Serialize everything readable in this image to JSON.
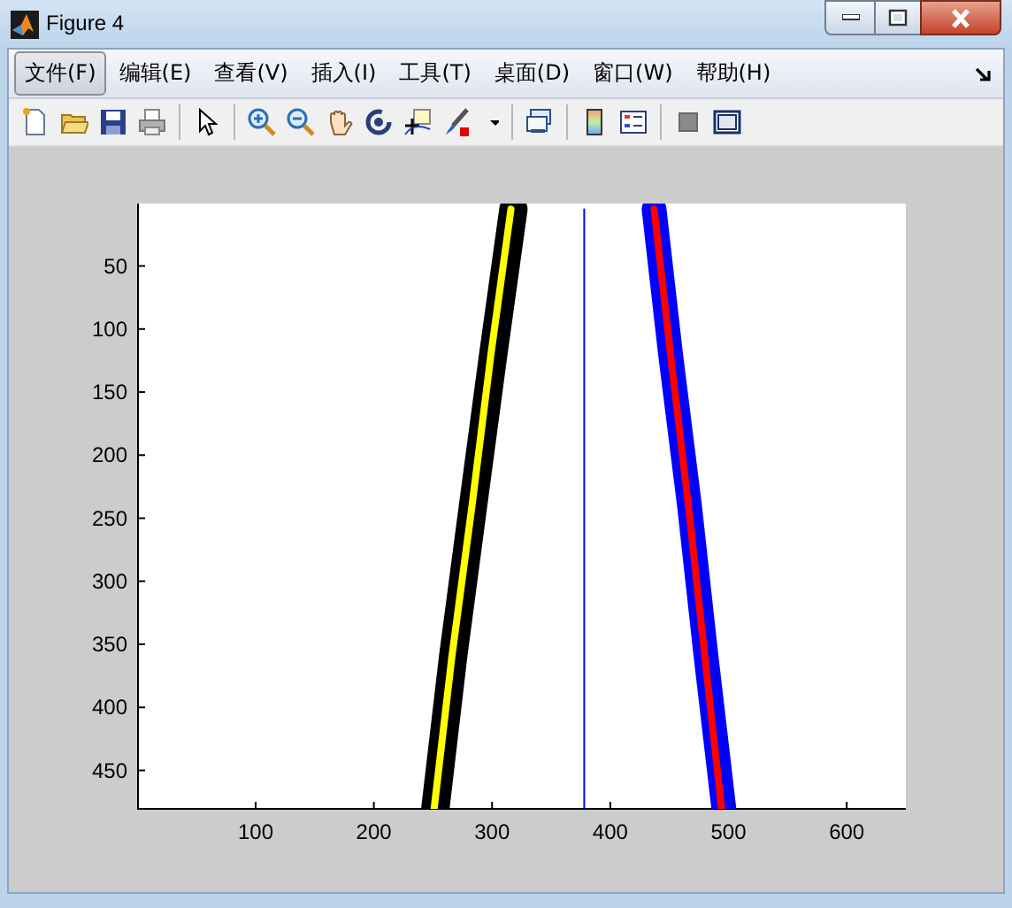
{
  "window": {
    "title": "Figure 4"
  },
  "menu": [
    {
      "label": "文件(F)",
      "selected": true
    },
    {
      "label": "编辑(E)",
      "selected": false
    },
    {
      "label": "查看(V)",
      "selected": false
    },
    {
      "label": "插入(I)",
      "selected": false
    },
    {
      "label": "工具(T)",
      "selected": false
    },
    {
      "label": "桌面(D)",
      "selected": false
    },
    {
      "label": "窗口(W)",
      "selected": false
    },
    {
      "label": "帮助(H)",
      "selected": false
    }
  ],
  "figure": {
    "chart_data": {
      "type": "line",
      "orientation": "horizontal",
      "x": [
        5,
        120,
        240,
        360,
        480
      ],
      "xlim": [
        0.5,
        650
      ],
      "ylim": [
        480.5,
        0.5
      ],
      "xticks": [
        100,
        200,
        300,
        400,
        500,
        600
      ],
      "yticks": [
        50,
        100,
        150,
        200,
        250,
        300,
        350,
        400,
        450
      ],
      "series": [
        {
          "color": "#000000",
          "values": [
            318,
            301,
            284,
            267,
            252
          ]
        },
        {
          "color": "#ffff00",
          "values": [
            316,
            299,
            283,
            266,
            251
          ]
        },
        {
          "color": "#0000ff",
          "values": [
            437,
            451,
            467,
            481,
            496
          ]
        },
        {
          "color": "#ff0000",
          "values": [
            437,
            451,
            466,
            480,
            494
          ]
        },
        {
          "color": "#0000ff",
          "values": [
            378,
            378,
            378,
            378,
            378
          ]
        }
      ]
    }
  }
}
